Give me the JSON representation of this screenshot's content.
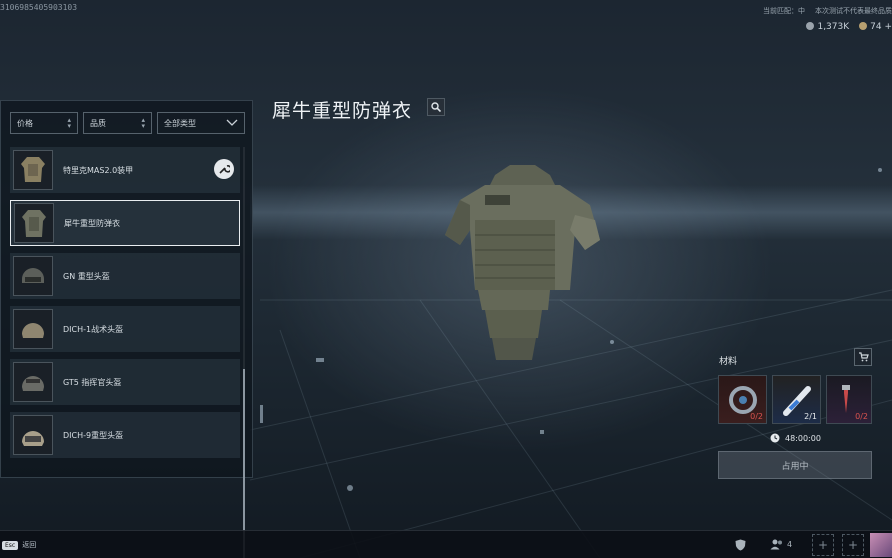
{
  "header": {
    "uid": "3106985405903103",
    "watermark": "",
    "status_left": "当前匹配：中",
    "status_right": "本次测试不代表最终品质",
    "currency": [
      {
        "icon": "silver-coin-icon",
        "value": "1,373K"
      },
      {
        "icon": "gold-coin-icon",
        "value": "74 +"
      }
    ]
  },
  "filters": {
    "price": "价格",
    "quality": "品质",
    "type": "全部类型"
  },
  "items": [
    {
      "name": "特里克MAS2.0装甲",
      "icon": "armor-icon",
      "has_wrench": true,
      "selected": false
    },
    {
      "name": "犀牛重型防弹衣",
      "icon": "armor-icon",
      "has_wrench": false,
      "selected": true
    },
    {
      "name": "GN 重型头盔",
      "icon": "helmet-icon",
      "has_wrench": false,
      "selected": false
    },
    {
      "name": "DICH-1战术头盔",
      "icon": "helmet-icon",
      "has_wrench": false,
      "selected": false
    },
    {
      "name": "GT5 指挥官头盔",
      "icon": "helmet-icon",
      "has_wrench": false,
      "selected": false
    },
    {
      "name": "DICH-9重型头盔",
      "icon": "helmet-icon",
      "has_wrench": false,
      "selected": false
    }
  ],
  "detail": {
    "title": "犀牛重型防弹衣"
  },
  "materials": {
    "label": "材料",
    "slots": [
      {
        "icon": "cable-reel-icon",
        "qty": "0/2",
        "insufficient": true
      },
      {
        "icon": "syringe-icon",
        "qty": "2/1",
        "insufficient": false
      },
      {
        "icon": "wrench-tool-icon",
        "qty": "0/2",
        "insufficient": true
      }
    ],
    "timer": "48:00:00",
    "action": "占用中"
  },
  "bottombar": {
    "esc_key": "Esc",
    "esc_label": "返回",
    "friends_count": "4"
  },
  "colors": {
    "accent_white": "#e9edf0",
    "insufficient": "#d9534f"
  }
}
